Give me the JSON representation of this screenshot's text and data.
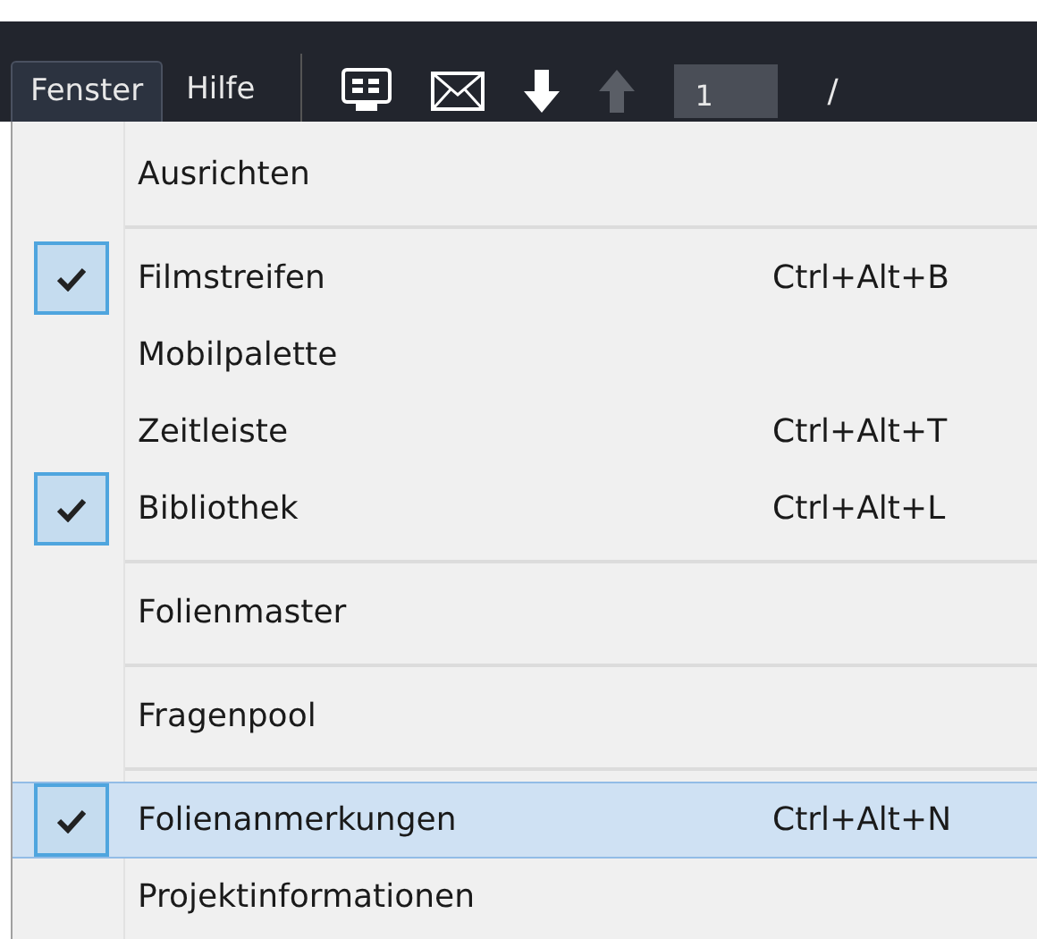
{
  "menubar": {
    "menus": [
      {
        "label": "Fenster",
        "selected": true
      },
      {
        "label": "Hilfe",
        "selected": false
      }
    ],
    "page_field": {
      "value": "1"
    },
    "page_separator": "/"
  },
  "menu": {
    "items": [
      {
        "kind": "item",
        "label": "Ausrichten",
        "checked": false,
        "selected": false
      },
      {
        "kind": "separator"
      },
      {
        "kind": "item",
        "label": "Filmstreifen",
        "shortcut": "Ctrl+Alt+B",
        "checked": true,
        "selected": false
      },
      {
        "kind": "item",
        "label": "Mobilpalette",
        "checked": false,
        "selected": false
      },
      {
        "kind": "item",
        "label": "Zeitleiste",
        "shortcut": "Ctrl+Alt+T",
        "checked": false,
        "selected": false
      },
      {
        "kind": "item",
        "label": "Bibliothek",
        "shortcut": "Ctrl+Alt+L",
        "checked": true,
        "selected": false
      },
      {
        "kind": "separator"
      },
      {
        "kind": "item",
        "label": "Folienmaster",
        "checked": false,
        "selected": false
      },
      {
        "kind": "separator"
      },
      {
        "kind": "item",
        "label": "Fragenpool",
        "checked": false,
        "selected": false
      },
      {
        "kind": "separator"
      },
      {
        "kind": "item",
        "label": "Folienanmerkungen",
        "shortcut": "Ctrl+Alt+N",
        "checked": true,
        "selected": true
      },
      {
        "kind": "item",
        "label": "Projektinformationen",
        "checked": false,
        "selected": false
      }
    ]
  }
}
